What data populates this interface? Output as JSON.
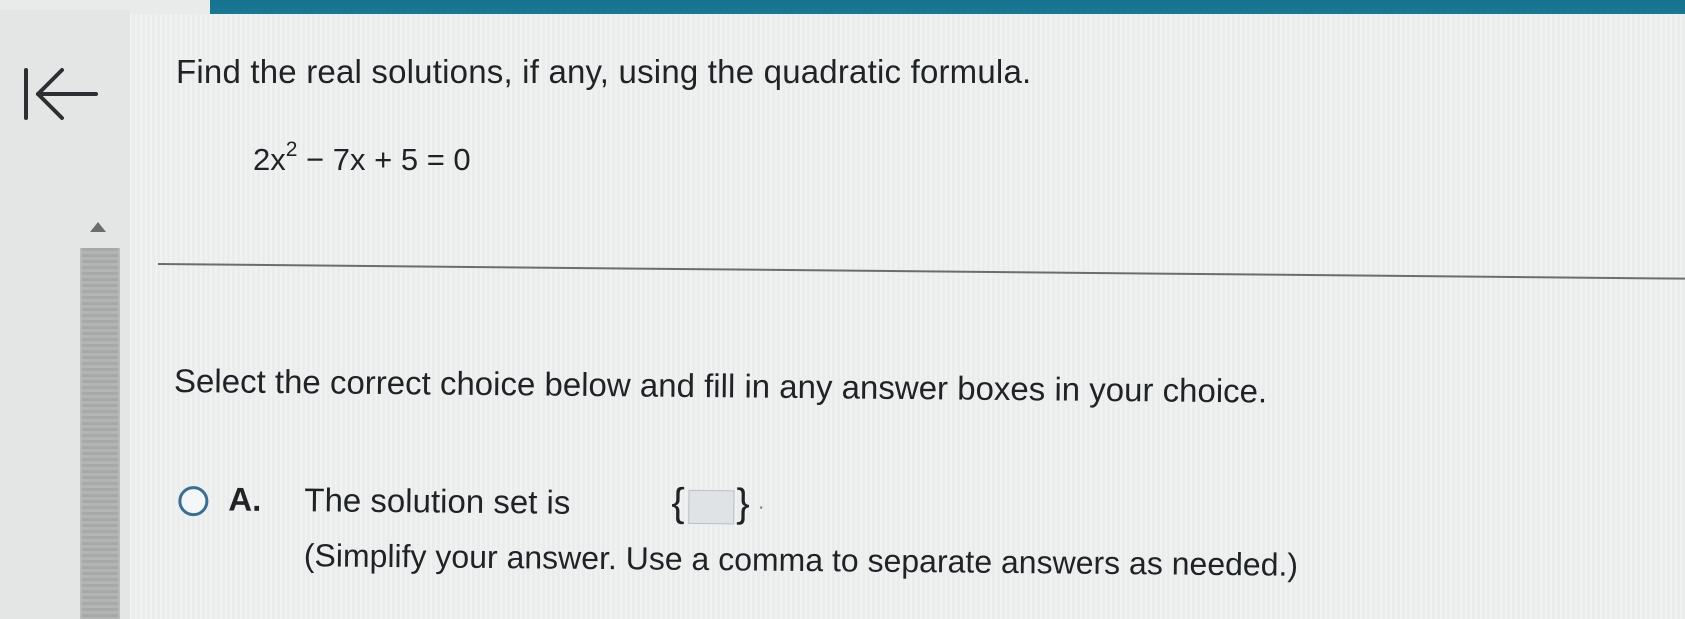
{
  "colors": {
    "header_bar": "#16718d",
    "radio_outline": "#3a6f95",
    "divider": "#6a6d70"
  },
  "navigation": {
    "back_icon": "arrow-left-to-bar-icon",
    "scroll_up_icon": "triangle-up-icon"
  },
  "question": {
    "prompt": "Find the real solutions, if any, using the quadratic formula.",
    "equation": {
      "lead": "2x",
      "exponent": "2",
      "rest": " − 7x + 5 = 0"
    }
  },
  "instruction": "Select the correct choice below and fill in any answer boxes in your choice.",
  "choices": [
    {
      "letter": "A.",
      "text": "The solution set is",
      "open_brace": "{",
      "close_brace": "}",
      "answer_value": "",
      "period": ".",
      "hint": "(Simplify your answer. Use a comma to separate answers as needed.)"
    }
  ]
}
